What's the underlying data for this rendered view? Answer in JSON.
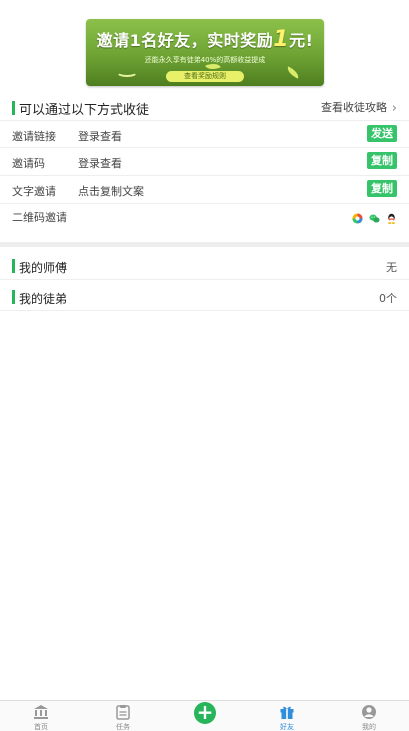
{
  "banner": {
    "title_pre": "邀请1名好友，实时奖励",
    "title_amount": "1",
    "title_unit": "元!",
    "subtitle": "还能永久享有徒弟40%的高额收益提成",
    "button": "查看奖励规则"
  },
  "invite_section": {
    "title": "可以通过以下方式收徒",
    "guide_link": "查看收徒攻略",
    "rows": [
      {
        "key": "邀请链接",
        "value": "登录查看",
        "action": "发送"
      },
      {
        "key": "邀请码",
        "value": "登录查看",
        "action": "复制"
      },
      {
        "key": "文字邀请",
        "value": "点击复制文案",
        "action": "复制"
      }
    ],
    "qr": {
      "key": "二维码邀请"
    }
  },
  "master": {
    "label": "我的师傅",
    "value": "无"
  },
  "disciples": {
    "label": "我的徒弟",
    "value": "0个"
  },
  "tabbar": {
    "items": [
      {
        "label": "首页",
        "icon": "bank-icon"
      },
      {
        "label": "任务",
        "icon": "task-icon"
      },
      {
        "label": "",
        "icon": "plus-icon"
      },
      {
        "label": "好友",
        "icon": "gift-icon",
        "active": true
      },
      {
        "label": "我的",
        "icon": "user-icon"
      }
    ]
  },
  "colors": {
    "accent": "#35c46a",
    "bar": "#27b45a",
    "active_tab": "#2f8fdc"
  }
}
